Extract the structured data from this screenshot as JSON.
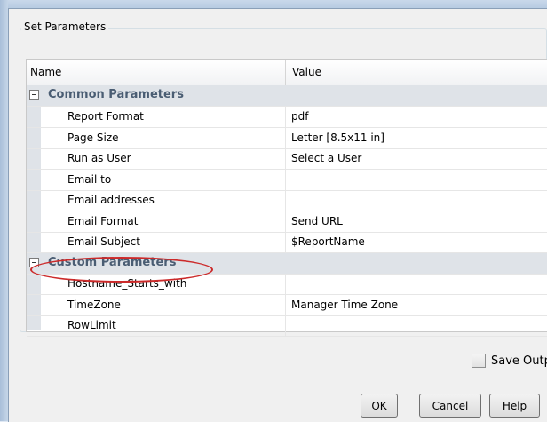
{
  "group_title": "Set Parameters",
  "columns": {
    "name": "Name",
    "value": "Value"
  },
  "sections": [
    {
      "title": "Common Parameters",
      "rows": [
        {
          "name": "Report Format",
          "value": "pdf"
        },
        {
          "name": "Page Size",
          "value": "Letter [8.5x11 in]"
        },
        {
          "name": "Run as User",
          "value": "Select a User"
        },
        {
          "name": "Email to",
          "value": ""
        },
        {
          "name": "Email addresses",
          "value": ""
        },
        {
          "name": "Email Format",
          "value": "Send URL"
        },
        {
          "name": "Email Subject",
          "value": "$ReportName"
        }
      ]
    },
    {
      "title": "Custom Parameters",
      "rows": [
        {
          "name": "Hostname_Starts_with",
          "value": ""
        },
        {
          "name": "TimeZone",
          "value": "Manager Time Zone"
        },
        {
          "name": "RowLimit",
          "value": ""
        }
      ]
    }
  ],
  "save_output": {
    "label": "Save Output",
    "checked": false
  },
  "buttons": {
    "ok": "OK",
    "cancel": "Cancel",
    "help": "Help"
  },
  "colors": {
    "annotation": "#cc2a2a",
    "category_bg": "#dfe3e8",
    "category_text": "#4a5d73"
  }
}
